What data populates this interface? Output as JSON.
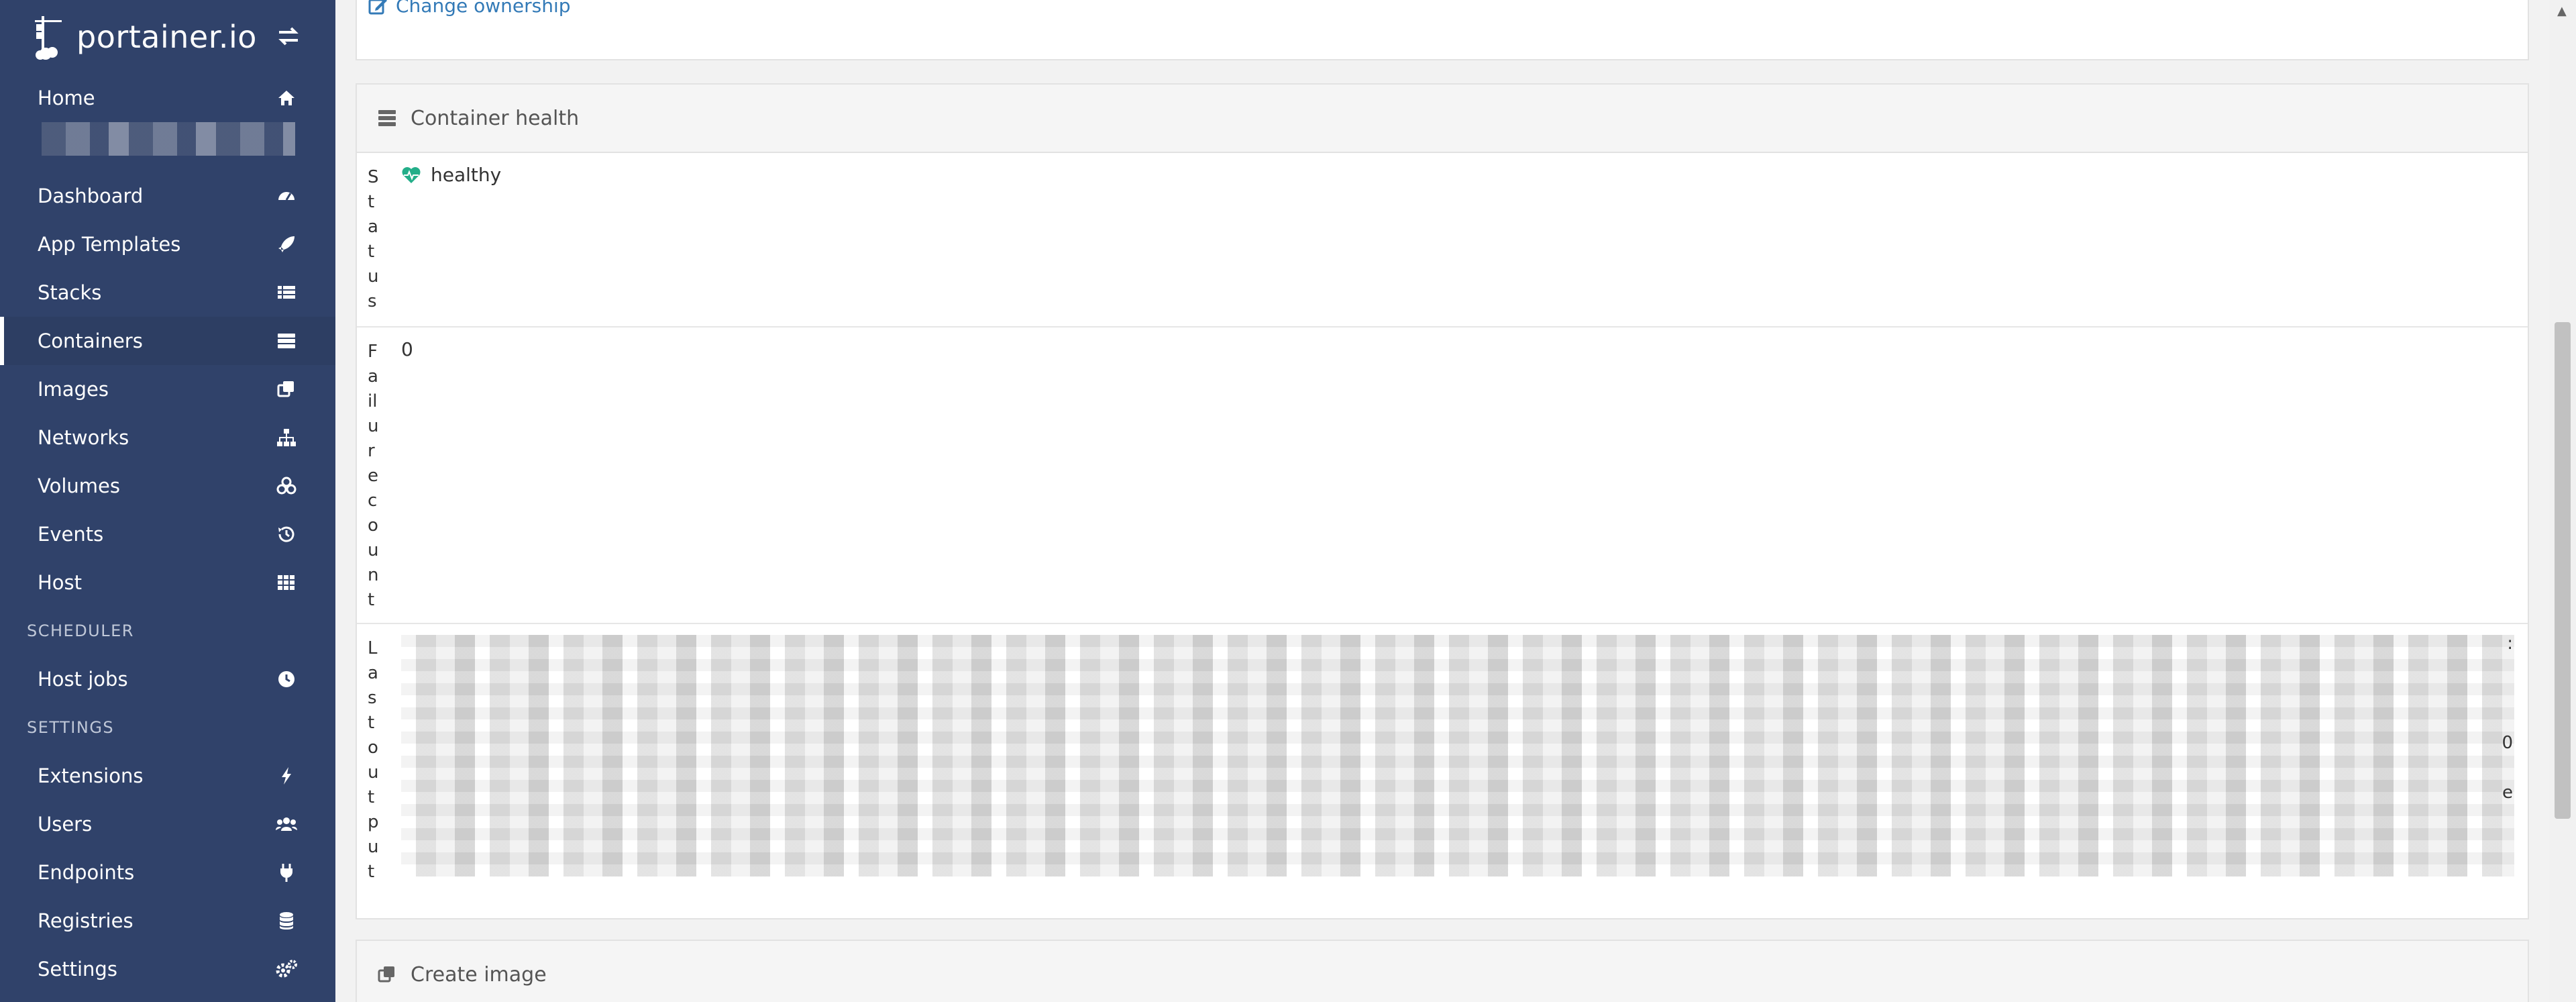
{
  "brand": {
    "name": "portainer.io"
  },
  "sidebar": {
    "items": [
      {
        "label": "Home",
        "icon": "home-icon"
      },
      {
        "label": "Dashboard",
        "icon": "tachometer-icon"
      },
      {
        "label": "App Templates",
        "icon": "rocket-icon"
      },
      {
        "label": "Stacks",
        "icon": "th-list-icon"
      },
      {
        "label": "Containers",
        "icon": "server-icon",
        "active": true
      },
      {
        "label": "Images",
        "icon": "clone-icon"
      },
      {
        "label": "Networks",
        "icon": "sitemap-icon"
      },
      {
        "label": "Volumes",
        "icon": "cubes-icon"
      },
      {
        "label": "Events",
        "icon": "history-icon"
      },
      {
        "label": "Host",
        "icon": "th-icon"
      }
    ],
    "scheduler_title": "SCHEDULER",
    "scheduler_items": [
      {
        "label": "Host jobs",
        "icon": "clock-icon"
      }
    ],
    "settings_title": "SETTINGS",
    "settings_items": [
      {
        "label": "Extensions",
        "icon": "bolt-icon"
      },
      {
        "label": "Users",
        "icon": "users-icon"
      },
      {
        "label": "Endpoints",
        "icon": "plug-icon"
      },
      {
        "label": "Registries",
        "icon": "database-icon"
      },
      {
        "label": "Settings",
        "icon": "cogs-icon"
      }
    ]
  },
  "main": {
    "change_ownership": "Change ownership",
    "health": {
      "title": "Container health",
      "status_label": "Status",
      "status_value": "healthy",
      "failure_label": "Failure count",
      "failure_value": "0",
      "output_label": "Last output",
      "output_edge_chars": [
        ":",
        "0",
        "e"
      ]
    },
    "create_image_title": "Create image"
  },
  "colors": {
    "sidebar_bg": "#30426a",
    "link": "#337ab7",
    "healthy": "#23ae89"
  }
}
